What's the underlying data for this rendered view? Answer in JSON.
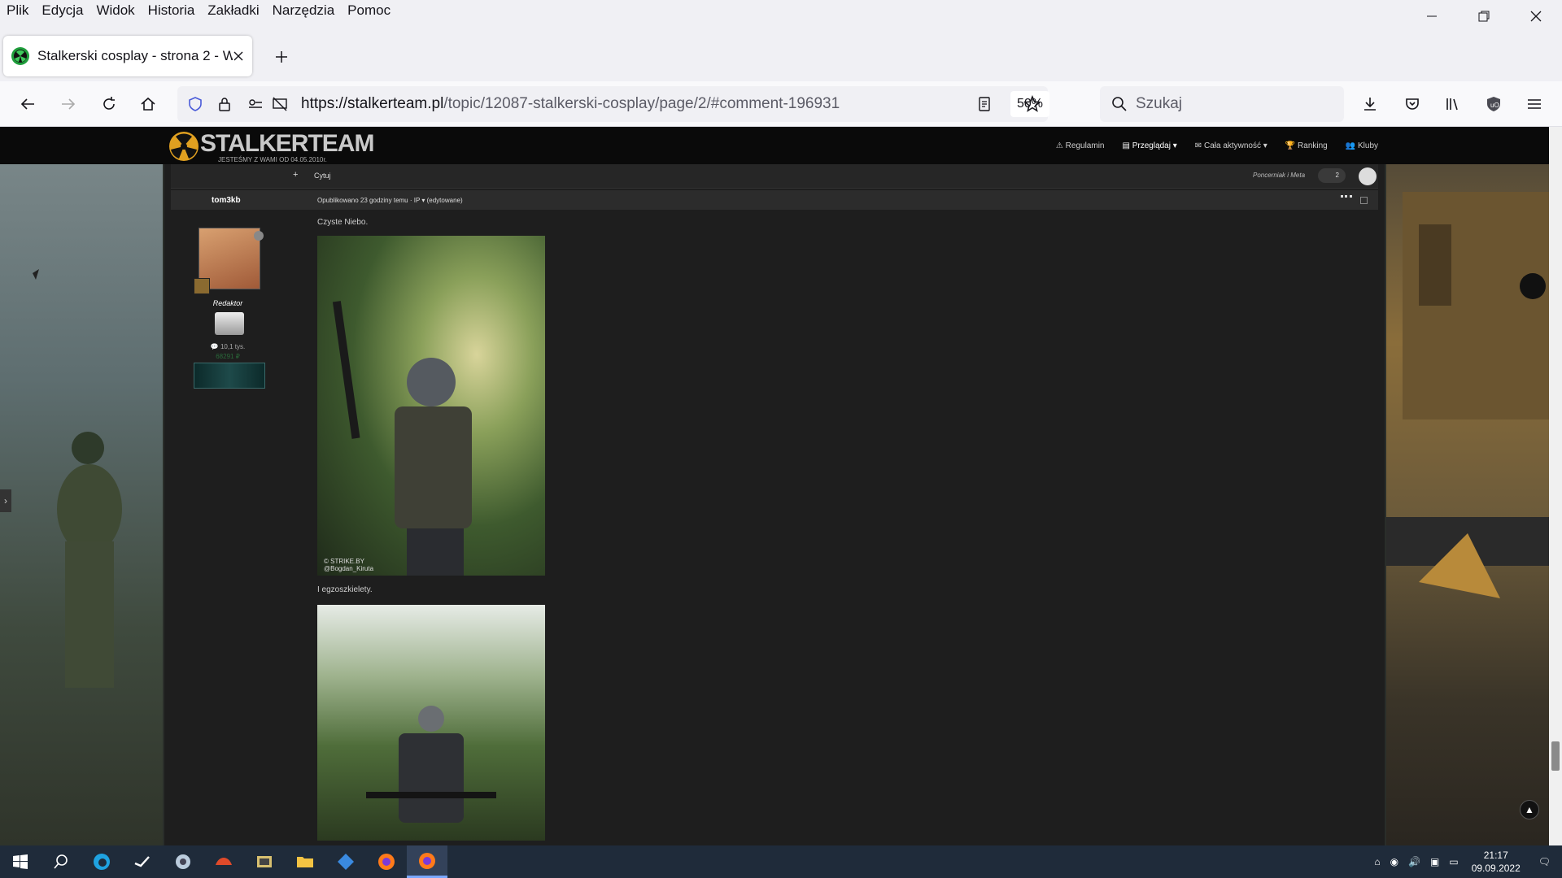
{
  "menu": [
    "Plik",
    "Edycja",
    "Widok",
    "Historia",
    "Zakładki",
    "Narzędzia",
    "Pomoc"
  ],
  "tab": {
    "title": "Stalkerski cosplay - strona 2 - W"
  },
  "nav": {
    "url_host": "https://stalkerteam.pl",
    "url_path": "/topic/12087-stalkerski-cosplay/page/2/#comment-196931",
    "zoom": "50%",
    "search_placeholder": "Szukaj"
  },
  "site": {
    "logo_title": "STALKERTEAM",
    "logo_subtitle": "JESTEŚMY Z WAMI OD 04.05.2010r.",
    "nav_items": [
      "Regulamin",
      "Przeglądaj",
      "Cała aktywność",
      "Ranking",
      "Kluby"
    ],
    "quote_label": "Cytuj",
    "reactions_text": "Poncerniak i Meta",
    "reaction_count": "2"
  },
  "post": {
    "author": "tom3kb",
    "meta": "Opublikowano 23 godziny temu · IP ▾ (edytowane)",
    "role": "Redaktor",
    "posts": "10,1 tys.",
    "points": "68291 ₽",
    "text1": "Czyste Niebo.",
    "text2": "I egzoszkielety.",
    "watermark": "© STRIKE.BY\n@Bogdan_Kiruta"
  },
  "taskbar": {
    "time": "21:17",
    "date": "09.09.2022"
  }
}
